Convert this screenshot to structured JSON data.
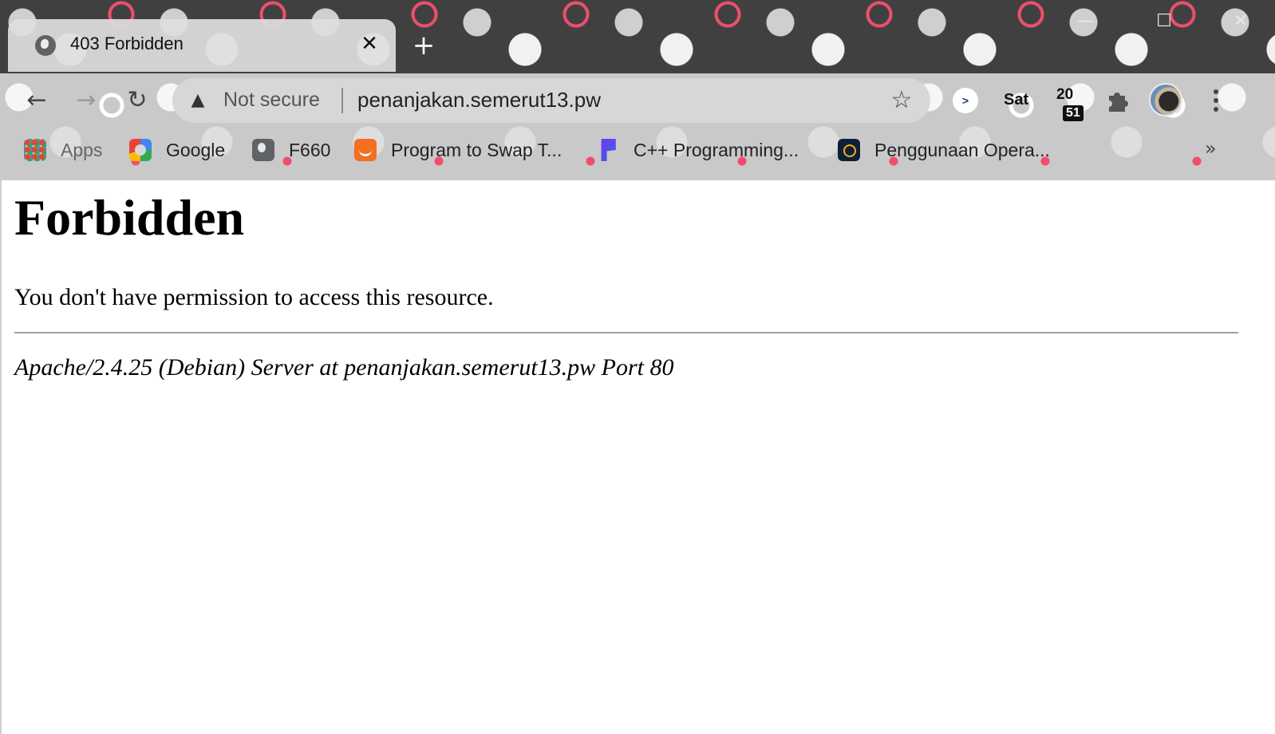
{
  "window": {
    "minimize_icon": "—",
    "maximize_icon": "☐",
    "close_icon": "✕"
  },
  "tab": {
    "title": "403 Forbidden",
    "close_icon": "✕"
  },
  "new_tab_icon": "+",
  "toolbar": {
    "back_icon": "←",
    "forward_icon": "→",
    "reload_icon": "↻",
    "security_label": "Not secure",
    "warning_icon": "▲",
    "url": "penanjakan.semerut13.pw",
    "bookmark_star_icon": "☆"
  },
  "extensions": {
    "day": "Sat",
    "clock_hour": "20",
    "clock_minute": "51"
  },
  "bookmarks": {
    "items": [
      {
        "label": "Apps",
        "icon": "apps-grid-icon"
      },
      {
        "label": "Google",
        "icon": "google-icon"
      },
      {
        "label": "F660",
        "icon": "globe-icon"
      },
      {
        "label": "Program to Swap T...",
        "icon": "site-icon"
      },
      {
        "label": "C++ Programming...",
        "icon": "site-icon"
      },
      {
        "label": "Penggunaan Opera...",
        "icon": "site-icon"
      }
    ],
    "more_icon": "»"
  },
  "page": {
    "heading": "Forbidden",
    "message": "You don't have permission to access this resource.",
    "server_signature": "Apache/2.4.25 (Debian) Server at penanjakan.semerut13.pw Port 80"
  },
  "colors": {
    "chrome_dark": "#404040",
    "chrome_light": "#c9c9c9",
    "accent_pink": "#ef4f6b"
  }
}
